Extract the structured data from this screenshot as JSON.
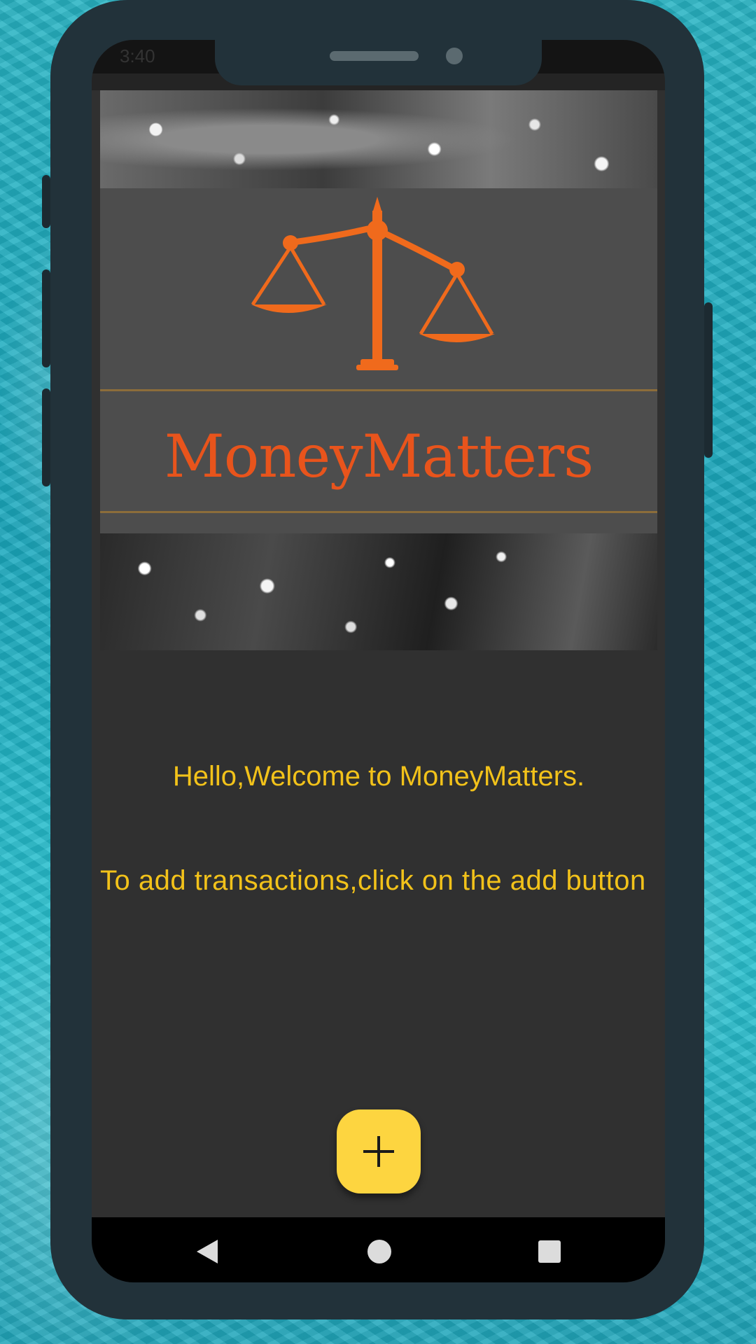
{
  "status_bar": {
    "time": "3:40"
  },
  "banner": {
    "brand_name": "MoneyMatters",
    "logo_icon": "scales-of-justice-icon",
    "logo_color": "#e8541c"
  },
  "content": {
    "welcome_text": "Hello,Welcome to MoneyMatters.",
    "instruction_text": "To add transactions,click on the add button",
    "text_color": "#f2c21a"
  },
  "fab": {
    "icon": "plus-icon",
    "color": "#fdd540"
  },
  "nav_bar": {
    "back_icon": "back-triangle-icon",
    "home_icon": "home-circle-icon",
    "recents_icon": "recents-square-icon"
  }
}
